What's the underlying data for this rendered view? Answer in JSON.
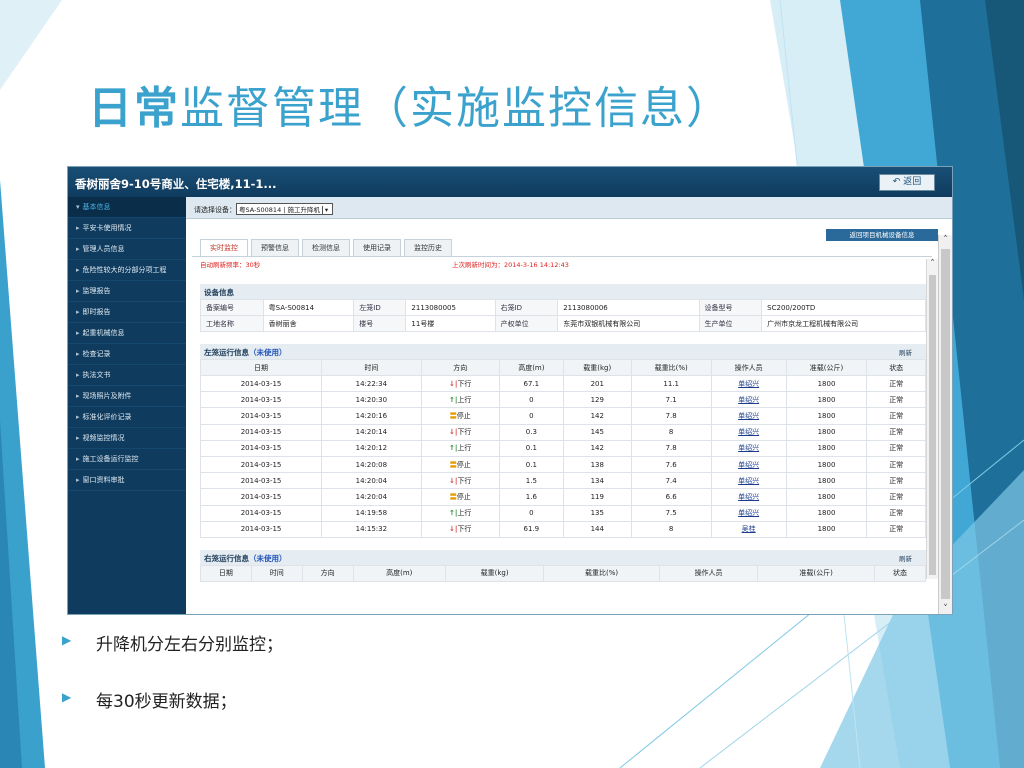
{
  "slide": {
    "title_bold": "日常",
    "title_rest": "监督管理（实施监控信息）",
    "bullets": [
      "升降机分左右分别监控；",
      "每30秒更新数据；"
    ]
  },
  "colors": {
    "accent": "#3aa2cc",
    "header_bg": "#0f3b5e",
    "alert_red": "#e02020",
    "link_blue": "#1a3d8f"
  },
  "window": {
    "title": "香树丽舍9-10号商业、住宅楼,11-1...",
    "back_label": "返回",
    "back_icon": "undo-arrow-icon"
  },
  "sidebar": {
    "items": [
      {
        "label": "基本信息"
      },
      {
        "label": "平安卡使用情况"
      },
      {
        "label": "管理人员信息"
      },
      {
        "label": "危险性较大的分部分项工程"
      },
      {
        "label": "监理报告"
      },
      {
        "label": "即时报告"
      },
      {
        "label": "起重机械信息"
      },
      {
        "label": "检查记录"
      },
      {
        "label": "执法文书"
      },
      {
        "label": "现场照片及附件"
      },
      {
        "label": "标准化评价记录"
      },
      {
        "label": "视频监控情况"
      },
      {
        "label": "施工设备运行监控"
      },
      {
        "label": "窗口资料审批"
      }
    ]
  },
  "toolbar": {
    "select_label": "请选择设备：",
    "select_value": "粤SA-S00814 | 施工升降机",
    "link_button": "返回项目机械设备信息"
  },
  "tabs": [
    {
      "label": "实时监控"
    },
    {
      "label": "预警信息"
    },
    {
      "label": "检测信息"
    },
    {
      "label": "使用记录"
    },
    {
      "label": "监控历史"
    }
  ],
  "refresh_rate": "自动刷新频率：30秒",
  "last_refresh": "上次刷新时间为：2014-3-16 14:12:43",
  "device_info": {
    "title": "设备信息",
    "rows": [
      [
        "备案编号",
        "粤SA-S00814",
        "左笼ID",
        "2113080005",
        "右笼ID",
        "2113080006",
        "设备型号",
        "SC200/200TD"
      ],
      [
        "工地名称",
        "香树丽舍",
        "楼号",
        "11号楼",
        "产权单位",
        "东莞市双银机械有限公司",
        "生产单位",
        "广州市京龙工程机械有限公司"
      ]
    ]
  },
  "left_cage": {
    "title": "左笼运行信息",
    "status": "（未使用）",
    "refresh": "刷新",
    "columns": [
      "日期",
      "时间",
      "方向",
      "高度(m)",
      "载重(kg)",
      "载重比(%)",
      "操作人员",
      "准载(公斤)",
      "状态"
    ],
    "rows": [
      [
        "2014-03-15",
        "14:22:34",
        "下行",
        "67.1",
        "201",
        "11.1",
        "单绍兴",
        "1800",
        "正常"
      ],
      [
        "2014-03-15",
        "14:20:30",
        "上行",
        "0",
        "129",
        "7.1",
        "单绍兴",
        "1800",
        "正常"
      ],
      [
        "2014-03-15",
        "14:20:16",
        "停止",
        "0",
        "142",
        "7.8",
        "单绍兴",
        "1800",
        "正常"
      ],
      [
        "2014-03-15",
        "14:20:14",
        "下行",
        "0.3",
        "145",
        "8",
        "单绍兴",
        "1800",
        "正常"
      ],
      [
        "2014-03-15",
        "14:20:12",
        "上行",
        "0.1",
        "142",
        "7.8",
        "单绍兴",
        "1800",
        "正常"
      ],
      [
        "2014-03-15",
        "14:20:08",
        "停止",
        "0.1",
        "138",
        "7.6",
        "单绍兴",
        "1800",
        "正常"
      ],
      [
        "2014-03-15",
        "14:20:04",
        "下行",
        "1.5",
        "134",
        "7.4",
        "单绍兴",
        "1800",
        "正常"
      ],
      [
        "2014-03-15",
        "14:20:04",
        "停止",
        "1.6",
        "119",
        "6.6",
        "单绍兴",
        "1800",
        "正常"
      ],
      [
        "2014-03-15",
        "14:19:58",
        "上行",
        "0",
        "135",
        "7.5",
        "单绍兴",
        "1800",
        "正常"
      ],
      [
        "2014-03-15",
        "14:15:32",
        "下行",
        "61.9",
        "144",
        "8",
        "吴桂",
        "1800",
        "正常"
      ]
    ]
  },
  "right_cage": {
    "title": "右笼运行信息",
    "status": "（未使用）",
    "refresh": "刷新",
    "columns": [
      "日期",
      "时间",
      "方向",
      "高度(m)",
      "载重(kg)",
      "载重比(%)",
      "操作人员",
      "准载(公斤)",
      "状态"
    ]
  }
}
